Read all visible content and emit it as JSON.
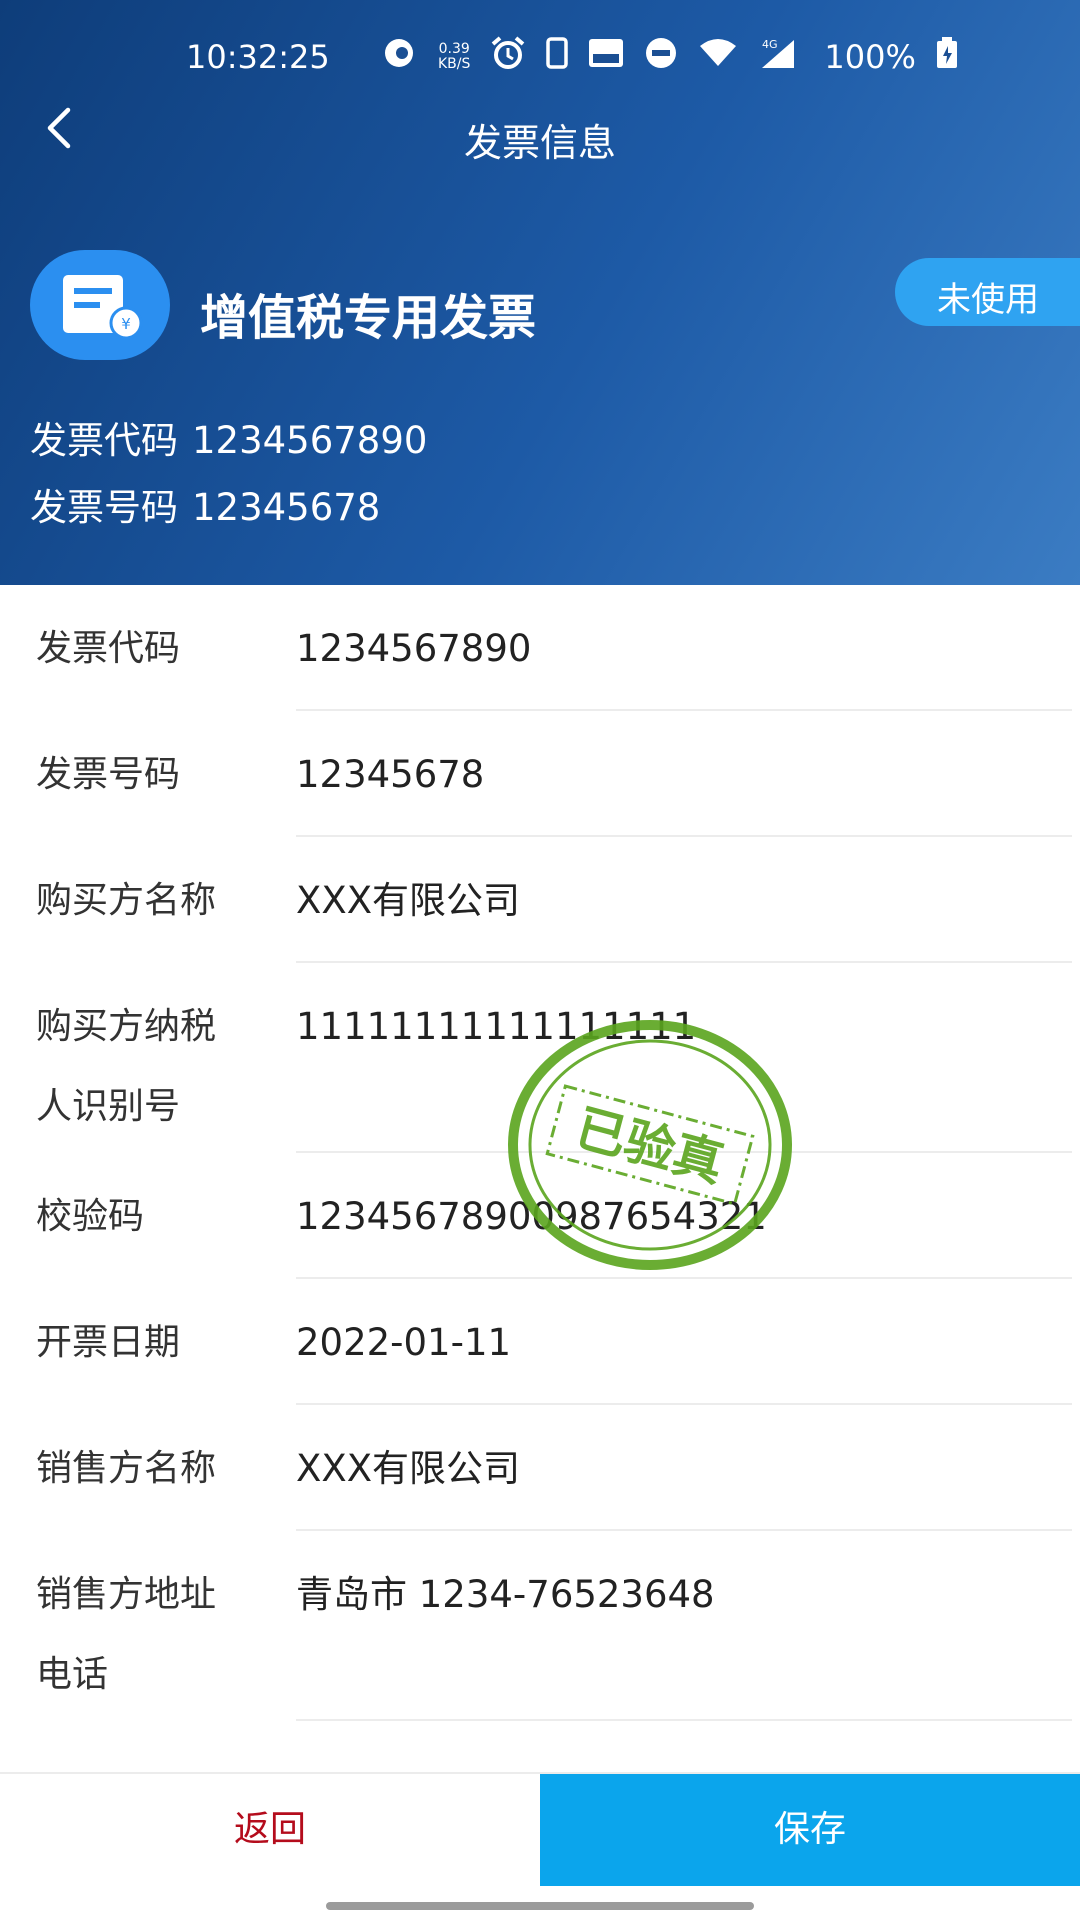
{
  "status_bar": {
    "time": "10:32:25",
    "net_speed_top": "0.39",
    "net_speed_bottom": "KB/S",
    "network": "4G",
    "battery": "100%"
  },
  "header": {
    "title": "发票信息",
    "invoice_type": "增值税专用发票",
    "status": "未使用",
    "code_label": "发票代码",
    "code_value": "1234567890",
    "number_label": "发票号码",
    "number_value": "12345678"
  },
  "fields": [
    {
      "label": "发票代码",
      "value": "1234567890"
    },
    {
      "label": "发票号码",
      "value": "12345678"
    },
    {
      "label": "购买方名称",
      "value": "XXX有限公司"
    },
    {
      "label": "购买方纳税人识别号",
      "label_line1": "购买方纳税",
      "label_line2": "人识别号",
      "value": "11111111111111111"
    },
    {
      "label": "校验码",
      "value": "12345678900987654321"
    },
    {
      "label": "开票日期",
      "value": "2022-01-11"
    },
    {
      "label": "销售方名称",
      "value": "XXX有限公司"
    },
    {
      "label": "销售方地址电话",
      "label_line1": "销售方地址",
      "label_line2": "电话",
      "value": "青岛市 1234-76523648"
    }
  ],
  "stamp": {
    "text": "已验真",
    "color": "#5aa51e"
  },
  "footer": {
    "back_label": "返回",
    "save_label": "保存"
  },
  "colors": {
    "header_start": "#0e3d7a",
    "header_end": "#3b7cc3",
    "accent": "#0ba5ec",
    "back_text": "#b40c1c"
  },
  "icons": [
    "back-icon",
    "invoice-icon",
    "alarm-icon",
    "wifi-icon",
    "signal-icon",
    "battery-icon"
  ]
}
